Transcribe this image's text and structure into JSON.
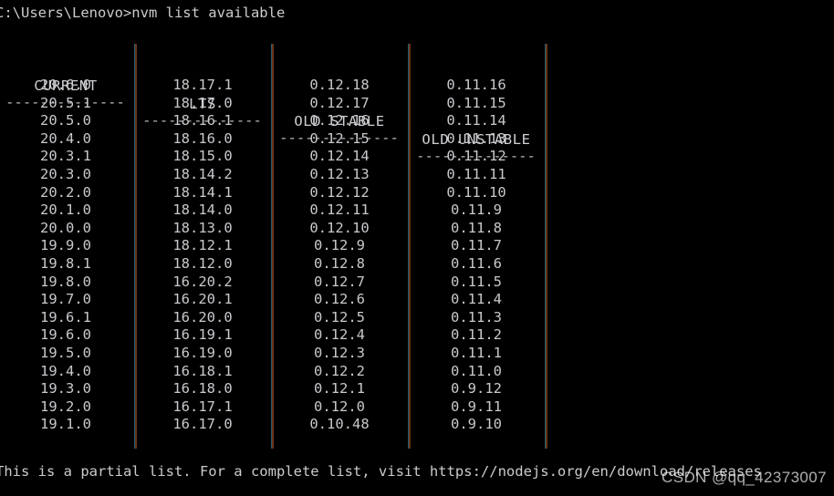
{
  "terminal": {
    "prompt_line": "C:\\Users\\Lenovo>nvm list available",
    "footer_line": "This is a partial list. For a complete list, visit https://nodejs.org/en/download/releases",
    "background_color": "#000000",
    "text_color": "#c9c9ce",
    "separator_color": "#1d5f72"
  },
  "watermark": {
    "text": "CSDN @qq_42373007"
  },
  "table": {
    "headers": [
      "CURRENT",
      "LTS",
      "OLD STABLE",
      "OLD UNSTABLE"
    ],
    "divider": "--------------",
    "rows": [
      [
        "20.6.0",
        "18.17.1",
        "0.12.18",
        "0.11.16"
      ],
      [
        "20.5.1",
        "18.17.0",
        "0.12.17",
        "0.11.15"
      ],
      [
        "20.5.0",
        "18.16.1",
        "0.12.16",
        "0.11.14"
      ],
      [
        "20.4.0",
        "18.16.0",
        "0.12.15",
        "0.11.13"
      ],
      [
        "20.3.1",
        "18.15.0",
        "0.12.14",
        "0.11.12"
      ],
      [
        "20.3.0",
        "18.14.2",
        "0.12.13",
        "0.11.11"
      ],
      [
        "20.2.0",
        "18.14.1",
        "0.12.12",
        "0.11.10"
      ],
      [
        "20.1.0",
        "18.14.0",
        "0.12.11",
        "0.11.9"
      ],
      [
        "20.0.0",
        "18.13.0",
        "0.12.10",
        "0.11.8"
      ],
      [
        "19.9.0",
        "18.12.1",
        "0.12.9",
        "0.11.7"
      ],
      [
        "19.8.1",
        "18.12.0",
        "0.12.8",
        "0.11.6"
      ],
      [
        "19.8.0",
        "16.20.2",
        "0.12.7",
        "0.11.5"
      ],
      [
        "19.7.0",
        "16.20.1",
        "0.12.6",
        "0.11.4"
      ],
      [
        "19.6.1",
        "16.20.0",
        "0.12.5",
        "0.11.3"
      ],
      [
        "19.6.0",
        "16.19.1",
        "0.12.4",
        "0.11.2"
      ],
      [
        "19.5.0",
        "16.19.0",
        "0.12.3",
        "0.11.1"
      ],
      [
        "19.4.0",
        "16.18.1",
        "0.12.2",
        "0.11.0"
      ],
      [
        "19.3.0",
        "16.18.0",
        "0.12.1",
        "0.9.12"
      ],
      [
        "19.2.0",
        "16.17.1",
        "0.12.0",
        "0.9.11"
      ],
      [
        "19.1.0",
        "16.17.0",
        "0.10.48",
        "0.9.10"
      ]
    ]
  }
}
